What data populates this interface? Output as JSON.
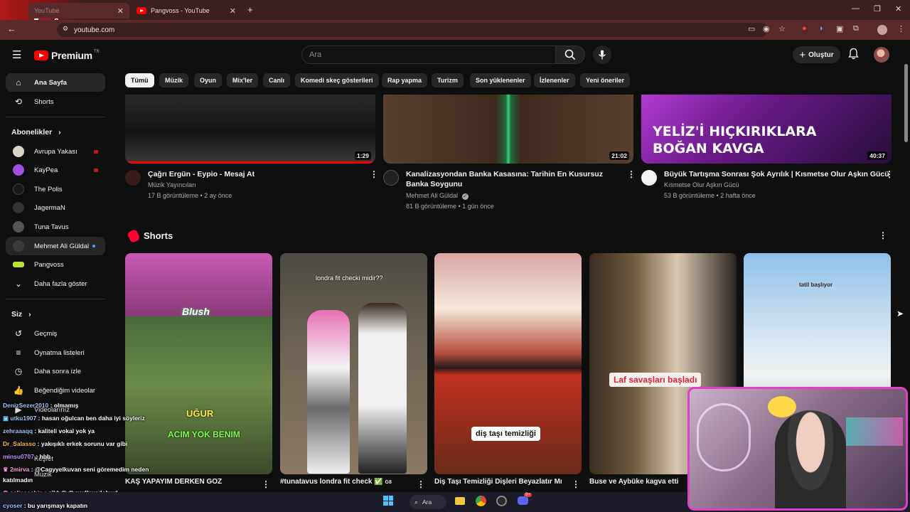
{
  "browser": {
    "tabs": [
      {
        "label": "YouTube",
        "active": true
      },
      {
        "label": "Pangvoss - YouTube",
        "active": false
      }
    ],
    "url": "youtube.com",
    "icons": [
      "back-icon",
      "site-info-icon",
      "cast-icon",
      "eye-slash-icon",
      "star-icon",
      "extensions-icon",
      "profile-icon",
      "menu-icon"
    ]
  },
  "header": {
    "logo_text": "Premium",
    "logo_region": "TR",
    "search_placeholder": "Ara",
    "create_label": "Oluştur"
  },
  "sidebar": {
    "main": [
      {
        "label": "Ana Sayfa",
        "icon": "home-icon",
        "active": true
      },
      {
        "label": "Shorts",
        "icon": "shorts-icon",
        "active": false
      }
    ],
    "subscriptions_title": "Abonelikler",
    "subscriptions": [
      {
        "label": "Avrupa Yakası",
        "color": "#d9d4c8",
        "badge": "live"
      },
      {
        "label": "KayPea",
        "color": "#a24fe0",
        "badge": "live"
      },
      {
        "label": "The Polis",
        "color": "#1a1a1a",
        "badge": ""
      },
      {
        "label": "JagermaN",
        "color": "#333333",
        "badge": ""
      },
      {
        "label": "Tuna Tavus",
        "color": "#555555",
        "badge": ""
      },
      {
        "label": "Mehmet Ali Güldal",
        "color": "#3a3a3a",
        "badge": "new"
      },
      {
        "label": "Pangvoss",
        "color": "#b9e33a",
        "badge": ""
      }
    ],
    "show_more_label": "Daha fazla göster",
    "you_title": "Siz",
    "you_items": [
      {
        "label": "Geçmiş",
        "icon": "history-icon"
      },
      {
        "label": "Oynatma listeleri",
        "icon": "playlists-icon"
      },
      {
        "label": "Daha sonra izle",
        "icon": "watch-later-icon"
      },
      {
        "label": "Beğendiğim videolar",
        "icon": "thumbs-up-icon"
      },
      {
        "label": "Videolarınız",
        "icon": "your-videos-icon"
      },
      {
        "label": "Keşfet",
        "icon": "explore-icon"
      },
      {
        "label": "Müzik",
        "icon": "music-icon"
      }
    ]
  },
  "chips": [
    "Tümü",
    "Müzik",
    "Oyun",
    "Mix'ler",
    "Canlı",
    "Komedi skeç gösterileri",
    "Rap yapma",
    "Turizm",
    "Son yüklenenler",
    "İzlenenler",
    "Yeni öneriler"
  ],
  "videos": [
    {
      "title": "Çağrı Ergün - Eypio - Mesaj At",
      "channel": "Müzik Yayıncıları",
      "views": "17 B görüntüleme",
      "ago": "2 ay önce",
      "duration": "1:29",
      "verified": false
    },
    {
      "title": "Kanalizasyondan Banka Kasasına: Tarihin En Kusursuz Banka Soygunu",
      "channel": "Mehmet Ali Güldal",
      "views": "81 B görüntüleme",
      "ago": "1 gün önce",
      "duration": "21:02",
      "verified": true
    },
    {
      "title": "Büyük Tartışma Sonrası Şok Ayrılık | Kısmetse Olur Aşkın Gücü",
      "channel": "Kısmetse Olur Aşkın Gücü",
      "views": "53 B görüntüleme",
      "ago": "2 hafta önce",
      "duration": "40:37",
      "verified": false
    }
  ],
  "thumb_text_3": "YELİZ'İ HIÇKIRIKLARA BOĞAN KAVGA",
  "shorts_title": "Shorts",
  "shorts": [
    {
      "title": "KAŞ YAPAYIM DERKEN GÖZ",
      "overlay": "ACIM YOK BENIM",
      "overlay2": "UĞUR",
      "badge": "Blush"
    },
    {
      "title": "#tunatavus londra fit check ✅",
      "overlay": "londra fit checki midir??",
      "suffix": "G8"
    },
    {
      "title": "Diş Taşı Temizliği Dişleri Beyazlatır Mı",
      "overlay": "diş taşı temizliği"
    },
    {
      "title": "Buse ve Aybüke kagva etti",
      "overlay": "Laf savaşları başladı"
    },
    {
      "title": "",
      "overlay": "tatil başlıyor"
    }
  ],
  "chat": [
    {
      "user": "DenizSezer2010",
      "msg": "olmamış"
    },
    {
      "user": "utku1907",
      "msg": "hasan oğulcan ben daha iyi söyleriz"
    },
    {
      "user": "zehraaaqq",
      "msg": "kaliteli vokal yok ya"
    },
    {
      "user": "Dr_Salasso",
      "msg": "yakışıklı erkek sorunu var gibi"
    },
    {
      "user": "minsu0707",
      "msg": "hbb"
    },
    {
      "user": "2mirva",
      "msg": "@Cagyyelkuvan seni göremedim neden"
    },
    {
      "user": "",
      "msg": "katılmadın"
    },
    {
      "user": "selinssahin",
      "msg": "sjkhdlıdhswdhwşdohwd"
    },
    {
      "user": "cyoser",
      "msg": "bu yarışmayı kapatın"
    }
  ],
  "taskbar": {
    "search_label": "Ara",
    "discord_badge": "9+"
  }
}
